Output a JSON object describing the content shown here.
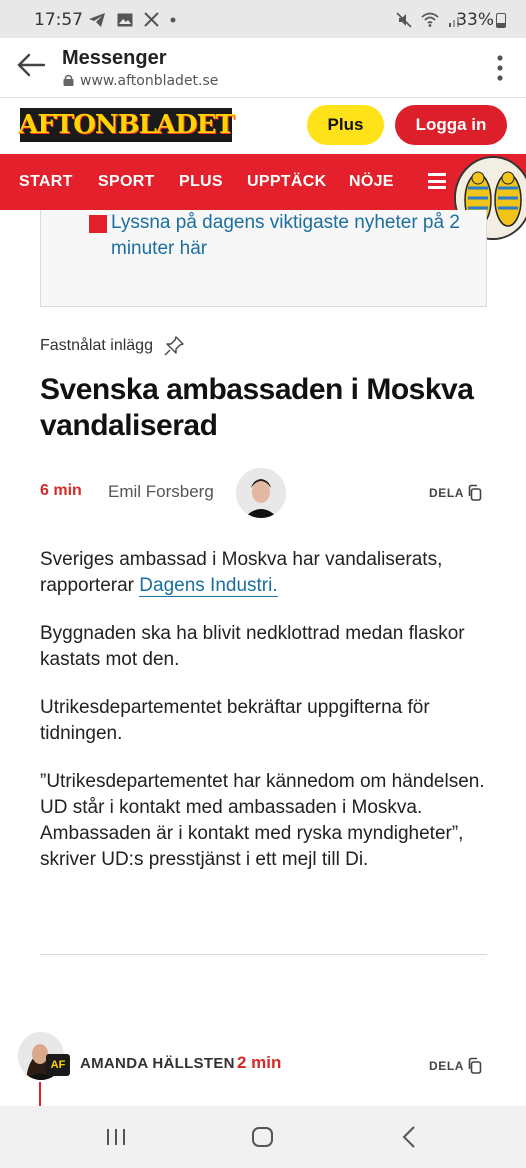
{
  "status": {
    "time": "17:57",
    "battery": "33%",
    "notif_icons": [
      "telegram-icon",
      "image-icon",
      "x-icon",
      "dot-icon"
    ],
    "right_icons": [
      "mute-icon",
      "wifi-icon",
      "signal-icon",
      "battery-icon"
    ]
  },
  "browser": {
    "title": "Messenger",
    "url": "www.aftonbladet.se"
  },
  "site": {
    "logo_text": "AFTONBLADET",
    "plus_label": "Plus",
    "login_label": "Logga in",
    "brand_red": "#e3202b",
    "brand_yellow": "#ffe21a"
  },
  "nav": {
    "items": [
      "START",
      "SPORT",
      "PLUS",
      "UPPTÄCK",
      "NÖJE"
    ]
  },
  "promo": {
    "link_text": "Lyssna på dagens viktigaste nyheter på 2 minuter här"
  },
  "post": {
    "pinned_label": "Fastnålat inlägg",
    "headline": "Svenska ambassaden i Moskva vandaliserad",
    "time_ago": "6 min",
    "author": "Emil Forsberg",
    "share_label": "DELA",
    "paragraph1_text": "Sveriges ambassad i Moskva har vandaliserats, rapporterar ",
    "paragraph1_link": "Dagens Industri.",
    "paragraph2": "Byggnaden ska ha blivit nedklottrad medan flaskor kastats mot den.",
    "paragraph3": "Utrikesdepartementet bekräftar uppgifterna för tidningen.",
    "paragraph4": "”Utrikesdepartementet har kännedom om händelsen. UD står i kontakt med ambassaden i Moskva. Ambassaden är i kontakt med ryska myndigheter”, skriver UD:s presstjänst i ett mejl till Di."
  },
  "next_post": {
    "author": "AMANDA HÄLLSTEN",
    "time_ago": "2 min",
    "badge": "AF",
    "share_label": "DELA"
  },
  "system_nav": [
    "recent-apps-icon",
    "home-icon",
    "back-icon"
  ]
}
